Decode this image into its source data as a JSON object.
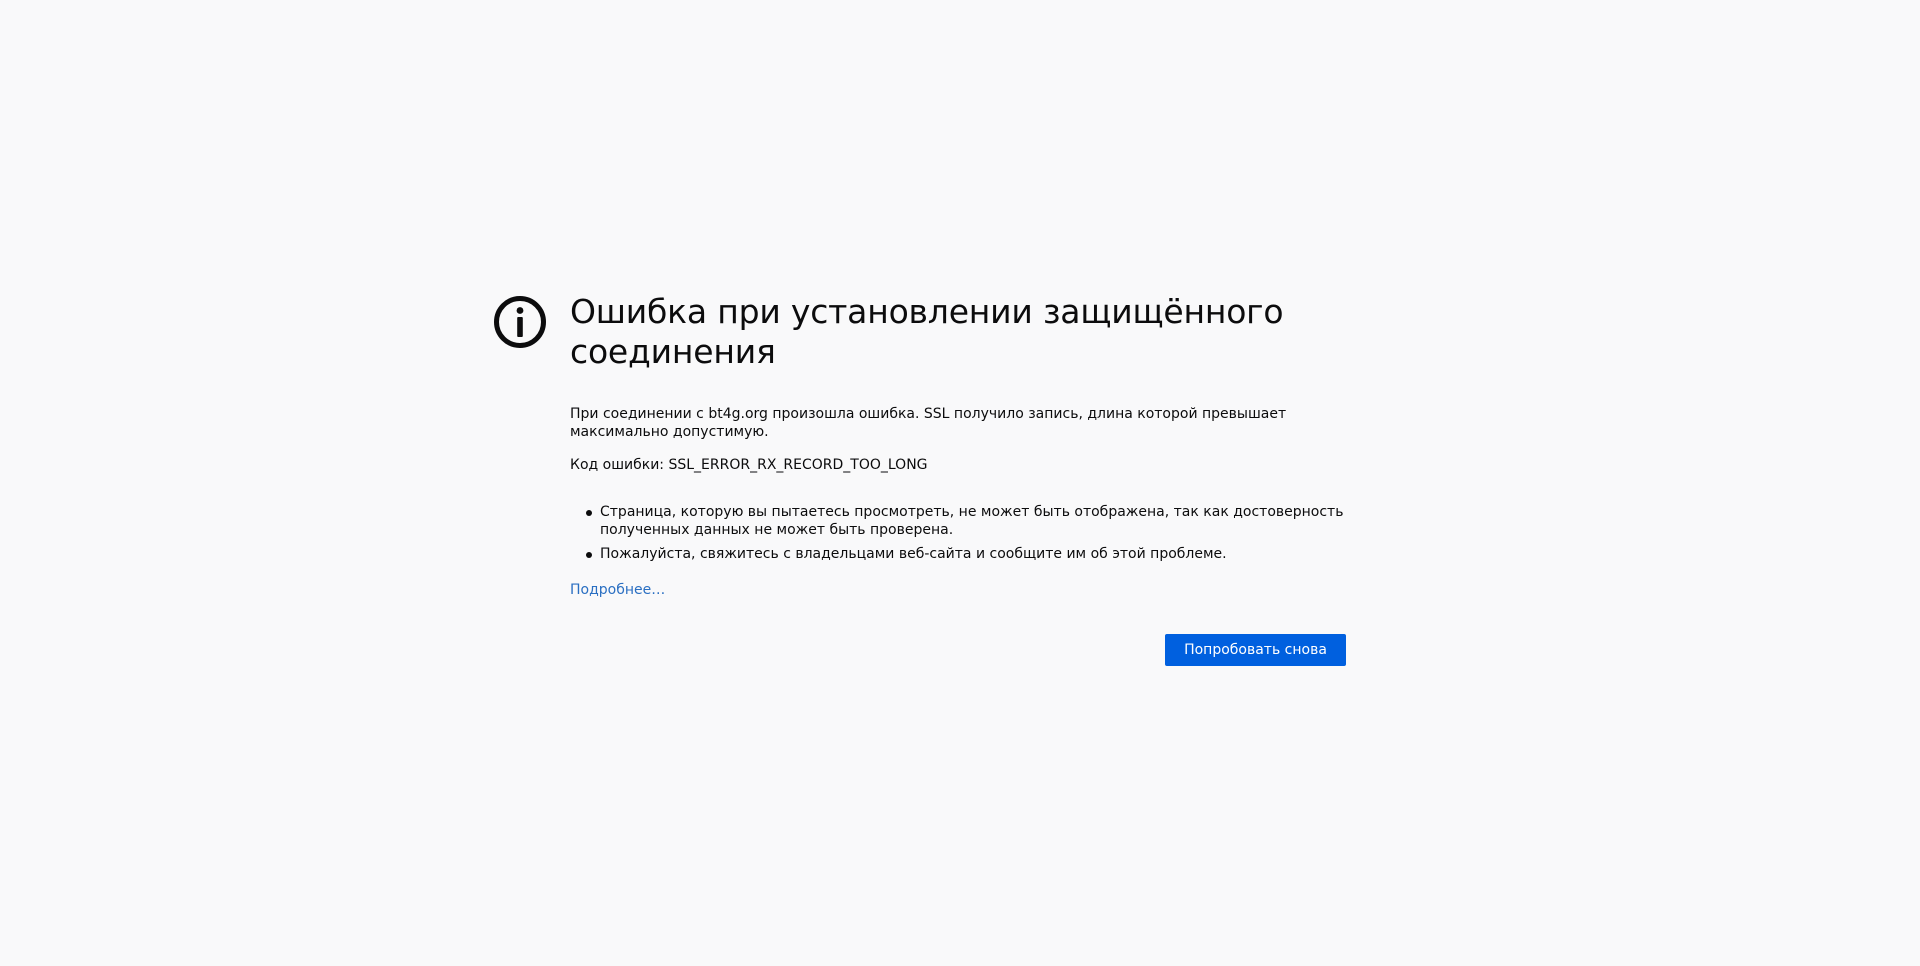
{
  "error_page": {
    "icon": "info-icon",
    "title": "Ошибка при установлении защищённого соединения",
    "description": "При соединении с bt4g.org произошла ошибка. SSL получило запись, длина которой превышает максимально допустимую.",
    "error_code_line": "Код ошибки: SSL_ERROR_RX_RECORD_TOO_LONG",
    "bullets": [
      "Страница, которую вы пытаетесь просмотреть, не может быть отображена, так как достоверность полученных данных не может быть проверена.",
      "Пожалуйста, свяжитесь с владельцами веб-сайта и сообщите им об этой проблеме."
    ],
    "learn_more_label": "Подробнее…",
    "try_again_label": "Попробовать снова"
  },
  "colors": {
    "background": "#f9f9fa",
    "text": "#0c0c0d",
    "link": "#2a6fc2",
    "button": "#0060df"
  }
}
